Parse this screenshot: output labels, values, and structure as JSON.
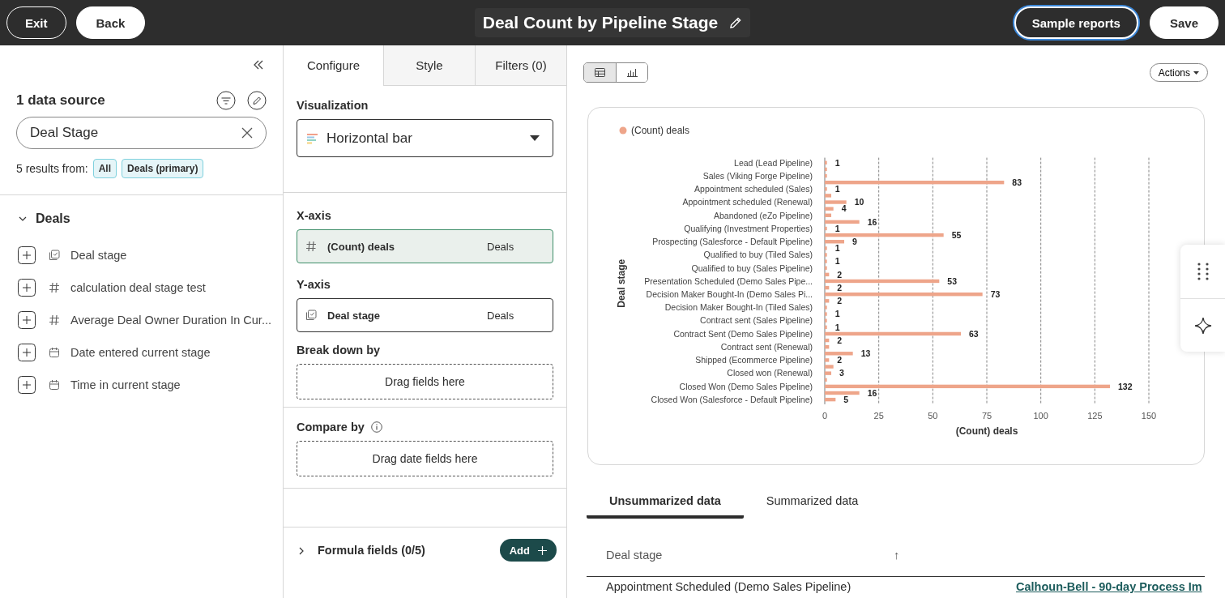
{
  "header": {
    "buttons_left": [
      {
        "label": "Exit",
        "kind": "dark"
      },
      {
        "label": "Back",
        "kind": "light"
      }
    ],
    "title": "Deal Count by Pipeline Stage",
    "buttons_right": [
      {
        "label": "Sample reports",
        "kind": "focused"
      },
      {
        "label": "Save",
        "kind": "light"
      }
    ]
  },
  "data_panel": {
    "title": "1 data source",
    "search": {
      "value": "Deal Stage"
    },
    "results_label": "5 results from:",
    "filters": [
      "All",
      "Deals (primary)"
    ],
    "group": {
      "label": "Deals",
      "expanded": true,
      "fields": [
        {
          "label": "Deal stage",
          "kind": "enum"
        },
        {
          "label": "calculation deal stage test",
          "kind": "number"
        },
        {
          "label": "Average Deal Owner Duration In Cur...",
          "kind": "number"
        },
        {
          "label": "Date entered current stage",
          "kind": "date"
        },
        {
          "label": "Time in current stage",
          "kind": "date"
        }
      ]
    }
  },
  "config_panel": {
    "tabs": [
      {
        "label": "Configure",
        "selected": true
      },
      {
        "label": "Style",
        "selected": false
      },
      {
        "label": "Filters (0)",
        "selected": false
      }
    ],
    "visualization": {
      "label": "Visualization",
      "value": "Horizontal bar"
    },
    "x_axis": {
      "label": "X-axis",
      "field": "(Count) deals",
      "source": "Deals",
      "kind": "number"
    },
    "y_axis": {
      "label": "Y-axis",
      "field": "Deal stage",
      "source": "Deals",
      "kind": "enum"
    },
    "break_down": {
      "label": "Break down by",
      "placeholder": "Drag fields here"
    },
    "compare": {
      "label": "Compare by",
      "placeholder": "Drag date fields here"
    },
    "formula": {
      "label": "Formula fields (0/5)",
      "expanded": false,
      "add": "Add"
    }
  },
  "view": {
    "modes": [
      {
        "kind": "table",
        "selected": true
      },
      {
        "kind": "chart",
        "selected": false
      }
    ],
    "actions": "Actions",
    "chart": {
      "chart_data": {
        "type": "bar",
        "orientation": "horizontal",
        "xlabel": "(Count) deals",
        "ylabel": "Deal stage",
        "xlim": [
          0,
          150
        ],
        "grid": true,
        "xticks": [
          0,
          25,
          50,
          75,
          100,
          125,
          150
        ],
        "categories": [
          "Lead (Lead Pipeline)",
          null,
          "Sales (Viking Forge Pipeline)",
          null,
          "Appointment scheduled (Sales)",
          null,
          "Appointment scheduled (Renewal)",
          null,
          "Abandoned (eZo Pipeline)",
          null,
          "Qualifying (Investment Properties)",
          null,
          "Prospecting (Salesforce - Default Pipeline)",
          null,
          "Qualified to buy (Tiled Sales)",
          null,
          "Qualified to buy (Sales Pipeline)",
          null,
          "Presentation Scheduled (Demo Sales Pipe...",
          null,
          "Decision Maker Bought-In (Demo Sales Pi...",
          null,
          "Decision Maker Bought-In (Tiled Sales)",
          null,
          "Contract sent (Sales Pipeline)",
          null,
          "Contract Sent (Demo Sales Pipeline)",
          null,
          "Contract sent (Renewal)",
          null,
          "Shipped (Ecommerce Pipeline)",
          null,
          "Closed won (Renewal)",
          null,
          "Closed Won (Demo Sales Pipeline)",
          null,
          "Closed Won (Salesforce - Default Pipeline)"
        ],
        "series": [
          {
            "name": "(Count) deals",
            "color": "#eea58a",
            "values": [
              1,
              1,
              1,
              83,
              1,
              3,
              10,
              4,
              3,
              16,
              1,
              55,
              9,
              1,
              1,
              1,
              1,
              2,
              53,
              2,
              73,
              2,
              1,
              1,
              1,
              1,
              63,
              2,
              2,
              13,
              2,
              4,
              3,
              1,
              132,
              16,
              5
            ]
          }
        ],
        "value_labels": [
          "1",
          null,
          null,
          "83",
          "1",
          null,
          "10",
          "4",
          null,
          "16",
          "1",
          "55",
          "9",
          "1",
          null,
          "1",
          null,
          "2",
          "53",
          "2",
          "73",
          "2",
          null,
          "1",
          null,
          "1",
          "63",
          "2",
          null,
          "13",
          "2",
          null,
          "3",
          null,
          "132",
          "16",
          "5"
        ]
      }
    },
    "data_tabs": [
      {
        "label": "Unsummarized data",
        "selected": true
      },
      {
        "label": "Summarized data",
        "selected": false
      }
    ],
    "table": {
      "columns": [
        {
          "label": "Deal stage",
          "sort_mark": "↑"
        }
      ],
      "rows": [
        [
          "Appointment Scheduled (Demo Sales Pipeline)",
          "Calhoun-Bell - 90-day Process Im"
        ]
      ]
    }
  }
}
